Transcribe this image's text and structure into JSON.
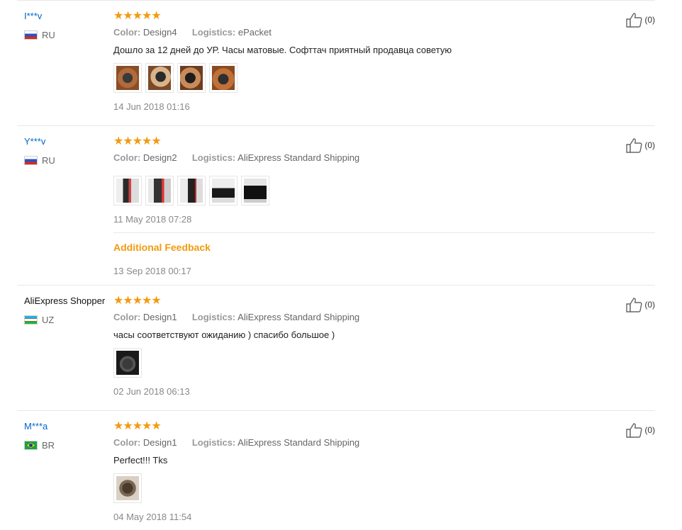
{
  "labels": {
    "color": "Color:",
    "logistics": "Logistics:"
  },
  "reviews": [
    {
      "user": "I***v",
      "country": "RU",
      "color": "Design4",
      "logistics": "ePacket",
      "text": "Дошло за 12 дней до УР. Часы матовые. Софттач приятный продавца советую",
      "photos": 4,
      "date": "14 Jun 2018 01:16",
      "likes": "(0)"
    },
    {
      "user": "Y***v",
      "country": "RU",
      "color": "Design2",
      "logistics": "AliExpress Standard Shipping",
      "text": "",
      "photos": 5,
      "date": "11 May 2018 07:28",
      "additional_feedback": "Additional Feedback",
      "additional_date": "13 Sep 2018 00:17",
      "likes": "(0)"
    },
    {
      "user": "AliExpress Shopper",
      "country": "UZ",
      "color": "Design1",
      "logistics": "AliExpress Standard Shipping",
      "text": "часы соответствуют ожиданию ) спасибо большое )",
      "photos": 1,
      "date": "02 Jun 2018 06:13",
      "likes": "(0)"
    },
    {
      "user": "M***a",
      "country": "BR",
      "color": "Design1",
      "logistics": "AliExpress Standard Shipping",
      "text": "Perfect!!! Tks",
      "photos": 1,
      "date": "04 May 2018 11:54",
      "likes": "(0)"
    }
  ]
}
